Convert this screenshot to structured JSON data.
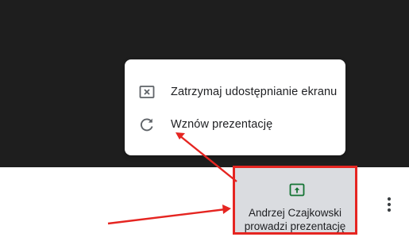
{
  "popup_menu": {
    "items": [
      {
        "label": "Zatrzymaj udostępnianie ekranu",
        "icon": "stop-share-icon"
      },
      {
        "label": "Wznów prezentację",
        "icon": "resume-icon"
      }
    ]
  },
  "presenter_tile": {
    "icon": "present-screen-icon",
    "line1": "Andrzej Czajkowski",
    "line2": "prowadzi prezentację"
  },
  "more_options": {
    "icon": "more-vertical-icon"
  },
  "colors": {
    "video_background": "#1e1e1e",
    "tile_background": "#dadce0",
    "tile_icon_green": "#137333",
    "annotation_red": "#e52521"
  }
}
